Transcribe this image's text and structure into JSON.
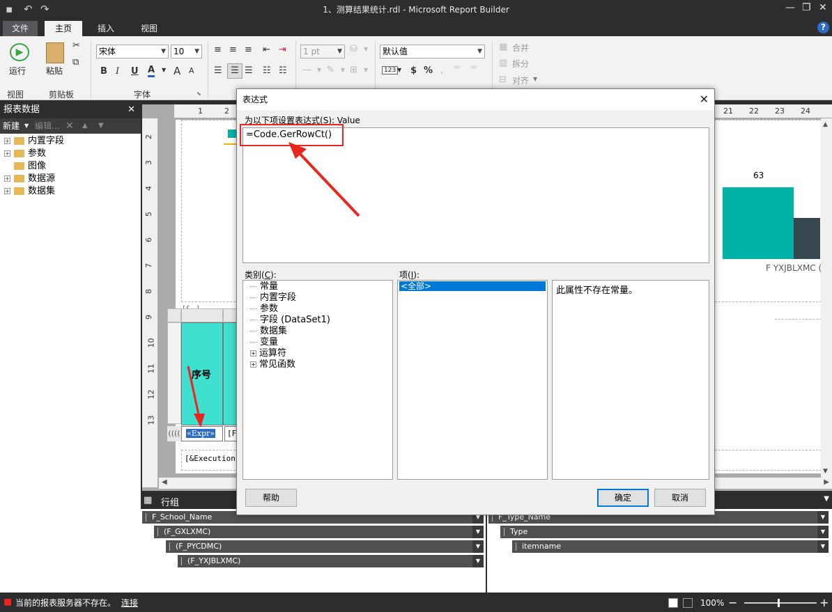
{
  "window": {
    "title": "1、测算结果统计.rdl - Microsoft Report Builder",
    "minimize": "—",
    "restore": "❐",
    "close": "✕"
  },
  "ribbon": {
    "tabs": [
      "文件",
      "主页",
      "插入",
      "视图"
    ],
    "help": "?",
    "run_label": "运行",
    "paste_label": "粘贴",
    "font_family": "宋体",
    "font_size": "10",
    "bold": "B",
    "italic": "I",
    "underline": "U",
    "font_color": "A",
    "grow_font": "A",
    "shrink_font": "A",
    "border_width": "1 pt",
    "number_format": "默认值",
    "number_placeholders": "123",
    "currency": "$",
    "percent": "%",
    "merge_label": "合并",
    "split_label": "拆分",
    "align_label": "对齐",
    "groups": [
      "视图",
      "剪贴板",
      "字体"
    ]
  },
  "left_panel": {
    "title": "报表数据",
    "new_label": "新建",
    "edit_label": "编辑...",
    "items": [
      {
        "label": "内置字段",
        "expandable": true
      },
      {
        "label": "参数",
        "expandable": true
      },
      {
        "label": "图像",
        "expandable": false
      },
      {
        "label": "数据源",
        "expandable": true
      },
      {
        "label": "数据集",
        "expandable": true
      }
    ]
  },
  "rulers": {
    "top": [
      "1",
      "2",
      "21",
      "22",
      "23",
      "24"
    ],
    "left": [
      "2",
      "3",
      "4",
      "5",
      "6",
      "7",
      "8",
      "9",
      "10",
      "11",
      "12",
      "13"
    ]
  },
  "report": {
    "chart_value_label": "63",
    "chart_axis_label": "F YXJBLXMC",
    "chart_axis_label_suffix": "(",
    "header_cell": "序号",
    "expr_cell": "«Expr»",
    "field_cell": "[F",
    "footer_text": "[&Execution",
    "bracket_text": "[&..]"
  },
  "groups": {
    "row_title": "行组",
    "row_groups": [
      "F_School_Name",
      "(F_GXLXMC)",
      "(F_PYCDMC)",
      "(F_YXJBLXMC)"
    ],
    "col_groups": [
      "F_Type_Name",
      "Type",
      "itemname"
    ]
  },
  "status": {
    "message": "当前的报表服务器不存在。",
    "link": "连接",
    "zoom": "100%"
  },
  "dialog": {
    "title": "表达式",
    "prompt_prefix": "为以下项设置表达式(",
    "prompt_key": "S",
    "prompt_suffix": "): Value",
    "expression": "=Code.GerRowCt()",
    "category_prefix": "类别(",
    "category_key": "C",
    "category_suffix": "):",
    "item_prefix": "项(",
    "item_key": "I",
    "item_suffix": "):",
    "categories": [
      {
        "label": "常量",
        "expandable": false
      },
      {
        "label": "内置字段",
        "expandable": false
      },
      {
        "label": "参数",
        "expandable": false
      },
      {
        "label": "字段 (DataSet1)",
        "expandable": false
      },
      {
        "label": "数据集",
        "expandable": false
      },
      {
        "label": "变量",
        "expandable": false
      },
      {
        "label": "运算符",
        "expandable": true
      },
      {
        "label": "常见函数",
        "expandable": true
      }
    ],
    "items": [
      "<全部>"
    ],
    "description": "此属性不存在常量。",
    "help_button": "帮助",
    "ok_button": "确定",
    "cancel_button": "取消"
  },
  "colors": {
    "accent": "#0078d7",
    "teal": "#00b3a6",
    "annotation": "#e8251f",
    "chrome": "#2d2d30"
  }
}
